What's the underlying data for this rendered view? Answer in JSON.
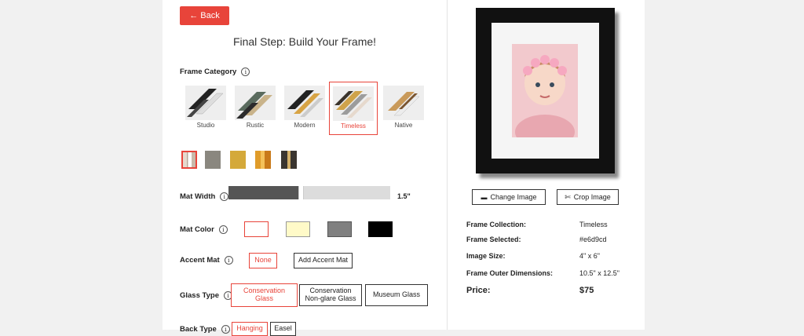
{
  "back_label": "← Back",
  "title": "Final Step: Build Your Frame!",
  "frame_category": {
    "label": "Frame Category",
    "items": [
      {
        "name": "Studio",
        "selected": false
      },
      {
        "name": "Rustic",
        "selected": false
      },
      {
        "name": "Modern",
        "selected": false
      },
      {
        "name": "Timeless",
        "selected": true
      },
      {
        "name": "Native",
        "selected": false
      }
    ]
  },
  "frame_swatches": {
    "colors": [
      "#e6d9cd",
      "#8a877f",
      "#d4a93a",
      "#e09c2a",
      "#3a3530"
    ],
    "selected_index": 0
  },
  "mat_width": {
    "label": "Mat Width",
    "value_text": "1.5\"",
    "level_percent": 44
  },
  "mat_color": {
    "label": "Mat Color",
    "colors": [
      "#ffffff",
      "#fffac8",
      "#808080",
      "#000000"
    ],
    "selected_index": 0
  },
  "accent_mat": {
    "label": "Accent Mat",
    "none_label": "None",
    "add_label": "Add Accent Mat"
  },
  "glass_type": {
    "label": "Glass Type",
    "options": [
      {
        "line1": "Conservation",
        "line2": "Glass",
        "selected": true
      },
      {
        "line1": "Conservation",
        "line2": "Non-glare Glass",
        "selected": false
      },
      {
        "line1": "Museum Glass",
        "line2": "",
        "selected": false
      }
    ]
  },
  "back_type": {
    "label": "Back Type",
    "options": [
      "Hanging",
      "Easel"
    ]
  },
  "preview": {
    "change_image_label": "Change Image",
    "crop_image_label": "Crop Image"
  },
  "summary": {
    "frame_collection_label": "Frame Collection:",
    "frame_collection_value": "Timeless",
    "frame_selected_label": "Frame Selected:",
    "frame_selected_value": "#e6d9cd",
    "image_size_label": "Image Size:",
    "image_size_value": "4\" x 6\"",
    "outer_dim_label": "Frame Outer Dimensions:",
    "outer_dim_value": "10.5\" x 12.5\"",
    "price_label": "Price:",
    "price_value": "$75"
  }
}
